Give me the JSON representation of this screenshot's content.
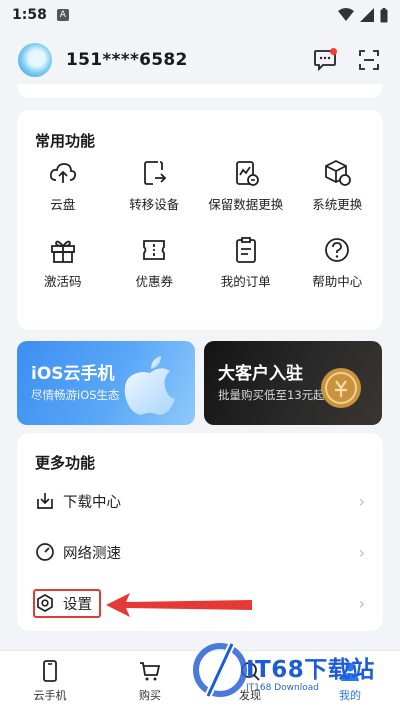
{
  "status_bar": {
    "time": "1:58",
    "notification_icon": "A"
  },
  "profile": {
    "phone": "151****6582"
  },
  "common": {
    "title": "常用功能",
    "items": [
      {
        "label": "云盘",
        "icon": "cloud-upload-icon"
      },
      {
        "label": "转移设备",
        "icon": "transfer-icon"
      },
      {
        "label": "保留数据更换",
        "icon": "keep-data-icon"
      },
      {
        "label": "系统更换",
        "icon": "system-cube-icon"
      },
      {
        "label": "激活码",
        "icon": "gift-icon"
      },
      {
        "label": "优惠券",
        "icon": "coupon-icon"
      },
      {
        "label": "我的订单",
        "icon": "order-icon"
      },
      {
        "label": "帮助中心",
        "icon": "help-icon"
      }
    ]
  },
  "banners": {
    "ios": {
      "title": "iOS云手机",
      "subtitle": "尽情畅游iOS生态"
    },
    "vip": {
      "title": "大客户入驻",
      "subtitle": "批量购买低至13元起!"
    }
  },
  "more": {
    "title": "更多功能",
    "items": [
      {
        "label": "下载中心",
        "icon": "download-icon"
      },
      {
        "label": "网络测速",
        "icon": "speed-icon"
      },
      {
        "label": "设置",
        "icon": "settings-icon"
      }
    ],
    "chevron": "›"
  },
  "tabs": [
    {
      "label": "云手机",
      "icon": "phone-icon"
    },
    {
      "label": "购买",
      "icon": "cart-icon"
    },
    {
      "label": "发现",
      "icon": "discover-icon"
    },
    {
      "label": "我的",
      "icon": "user-icon"
    }
  ],
  "watermark": {
    "text": "IT68下载站",
    "sub": "IT168 Download"
  },
  "colors": {
    "accent": "#2b78f2",
    "highlight": "#e53935",
    "background": "#f2f4f7"
  }
}
